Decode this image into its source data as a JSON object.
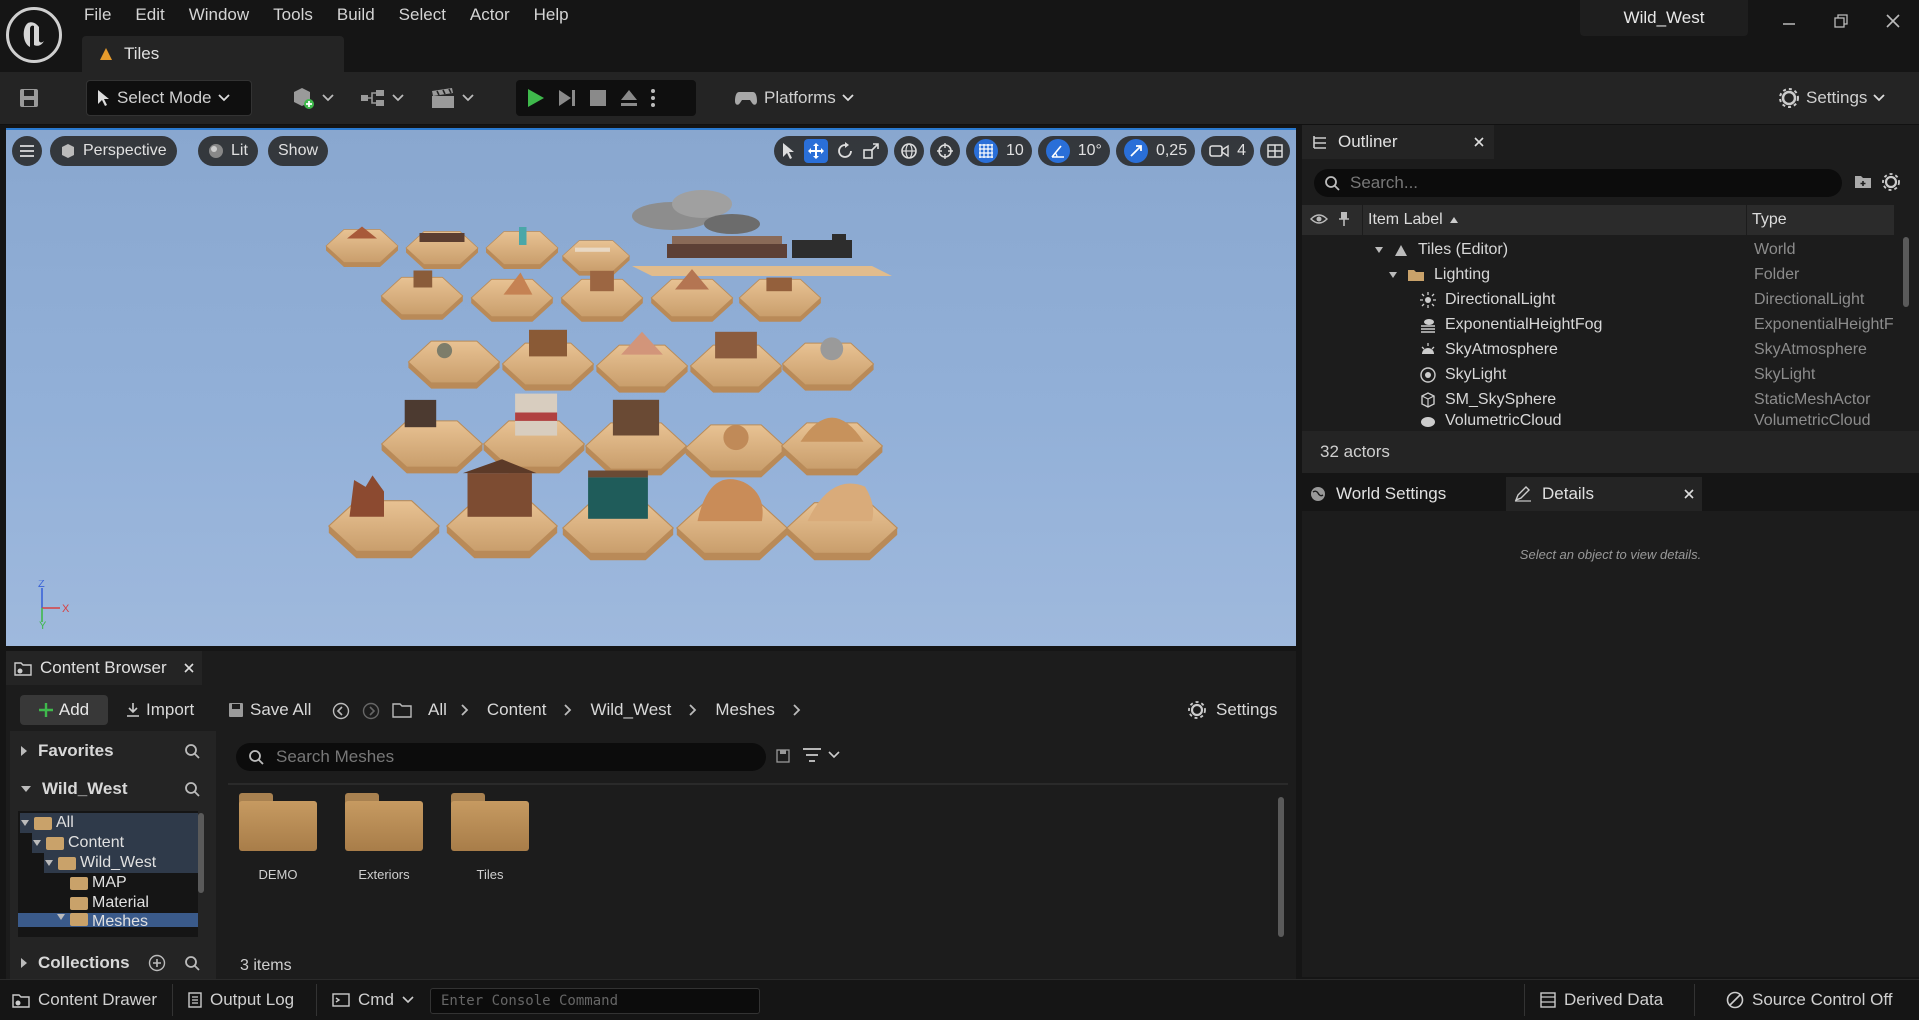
{
  "menu": [
    "File",
    "Edit",
    "Window",
    "Tools",
    "Build",
    "Select",
    "Actor",
    "Help"
  ],
  "document_tab": "Tiles",
  "project_name": "Wild_West",
  "toolbar": {
    "select_mode": "Select Mode",
    "platforms": "Platforms",
    "settings": "Settings"
  },
  "viewport": {
    "perspective": "Perspective",
    "lit": "Lit",
    "show": "Show",
    "grid_snap": "10",
    "rotation_snap": "10°",
    "scale_snap": "0,25",
    "camera_speed": "4"
  },
  "outliner": {
    "title": "Outliner",
    "search_placeholder": "Search...",
    "col_label": "Item Label",
    "col_type": "Type",
    "rows": [
      {
        "label": "Tiles (Editor)",
        "type": "World"
      },
      {
        "label": "Lighting",
        "type": "Folder"
      },
      {
        "label": "DirectionalLight",
        "type": "DirectionalLight"
      },
      {
        "label": "ExponentialHeightFog",
        "type": "ExponentialHeightF"
      },
      {
        "label": "SkyAtmosphere",
        "type": "SkyAtmosphere"
      },
      {
        "label": "SkyLight",
        "type": "SkyLight"
      },
      {
        "label": "SM_SkySphere",
        "type": "StaticMeshActor"
      },
      {
        "label": "VolumetricCloud",
        "type": "VolumetricCloud"
      }
    ],
    "actor_count": "32 actors"
  },
  "details": {
    "world_settings_tab": "World Settings",
    "details_tab": "Details",
    "empty_message": "Select an object to view details."
  },
  "content_browser": {
    "title": "Content Browser",
    "add": "Add",
    "import": "Import",
    "save_all": "Save All",
    "breadcrumb": [
      "All",
      "Content",
      "Wild_West",
      "Meshes"
    ],
    "settings": "Settings",
    "favorites": "Favorites",
    "project": "Wild_West",
    "collections": "Collections",
    "tree": [
      "All",
      "Content",
      "Wild_West",
      "MAP",
      "Material",
      "Meshes"
    ],
    "search_placeholder": "Search Meshes",
    "assets": [
      "DEMO",
      "Exteriors",
      "Tiles"
    ],
    "item_count": "3 items"
  },
  "statusbar": {
    "content_drawer": "Content Drawer",
    "output_log": "Output Log",
    "cmd": "Cmd",
    "console_placeholder": "Enter Console Command",
    "derived_data": "Derived Data",
    "source_control": "Source Control Off"
  },
  "colors": {
    "accent_blue": "#2a7ad0",
    "play_green": "#3fb94c",
    "folder": "#c69a61",
    "sky": "#92b0d8"
  }
}
